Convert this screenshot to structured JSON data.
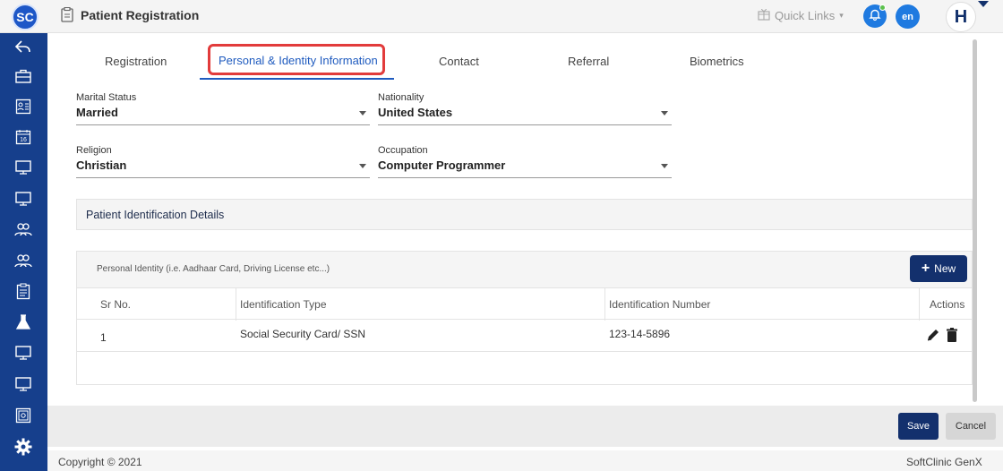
{
  "app": {
    "logo_text": "SC",
    "page_title": "Patient Registration"
  },
  "header": {
    "quick_links": "Quick Links",
    "lang": "en",
    "hospital_initial": "H"
  },
  "sidebar": {
    "items": [
      {
        "icon": "back-arrow-icon"
      },
      {
        "icon": "briefcase-icon"
      },
      {
        "icon": "id-card-icon"
      },
      {
        "icon": "calendar-icon"
      },
      {
        "icon": "monitor-icon"
      },
      {
        "icon": "monitor-icon"
      },
      {
        "icon": "users-icon"
      },
      {
        "icon": "users-icon"
      },
      {
        "icon": "clipboard-icon"
      },
      {
        "icon": "flask-icon"
      },
      {
        "icon": "monitor-icon"
      },
      {
        "icon": "monitor-icon"
      },
      {
        "icon": "safe-icon"
      },
      {
        "icon": "gear-icon"
      }
    ]
  },
  "tabs": [
    {
      "label": "Registration"
    },
    {
      "label": "Personal & Identity Information",
      "active": true
    },
    {
      "label": "Contact"
    },
    {
      "label": "Referral"
    },
    {
      "label": "Biometrics"
    }
  ],
  "form": {
    "marital_status": {
      "label": "Marital Status",
      "value": "Married"
    },
    "nationality": {
      "label": "Nationality",
      "value": "United States"
    },
    "religion": {
      "label": "Religion",
      "value": "Christian"
    },
    "occupation": {
      "label": "Occupation",
      "value": "Computer Programmer"
    }
  },
  "identification": {
    "section_title": "Patient Identification Details",
    "panel_label": "Personal Identity (i.e. Aadhaar Card, Driving License etc...)",
    "new_button": "New",
    "columns": [
      "Sr No.",
      "Identification Type",
      "Identification Number",
      "Actions"
    ],
    "rows": [
      {
        "sr": "1",
        "type": "Social Security Card/ SSN",
        "number": "123-14-5896"
      }
    ]
  },
  "actions": {
    "save": "Save",
    "cancel": "Cancel"
  },
  "footer": {
    "copyright": "Copyright © 2021",
    "brand": "SoftClinic GenX"
  },
  "colors": {
    "primary": "#13306d",
    "sidebar": "#163f8c",
    "accent": "#1f5bbf",
    "highlight": "#e23b3b"
  }
}
